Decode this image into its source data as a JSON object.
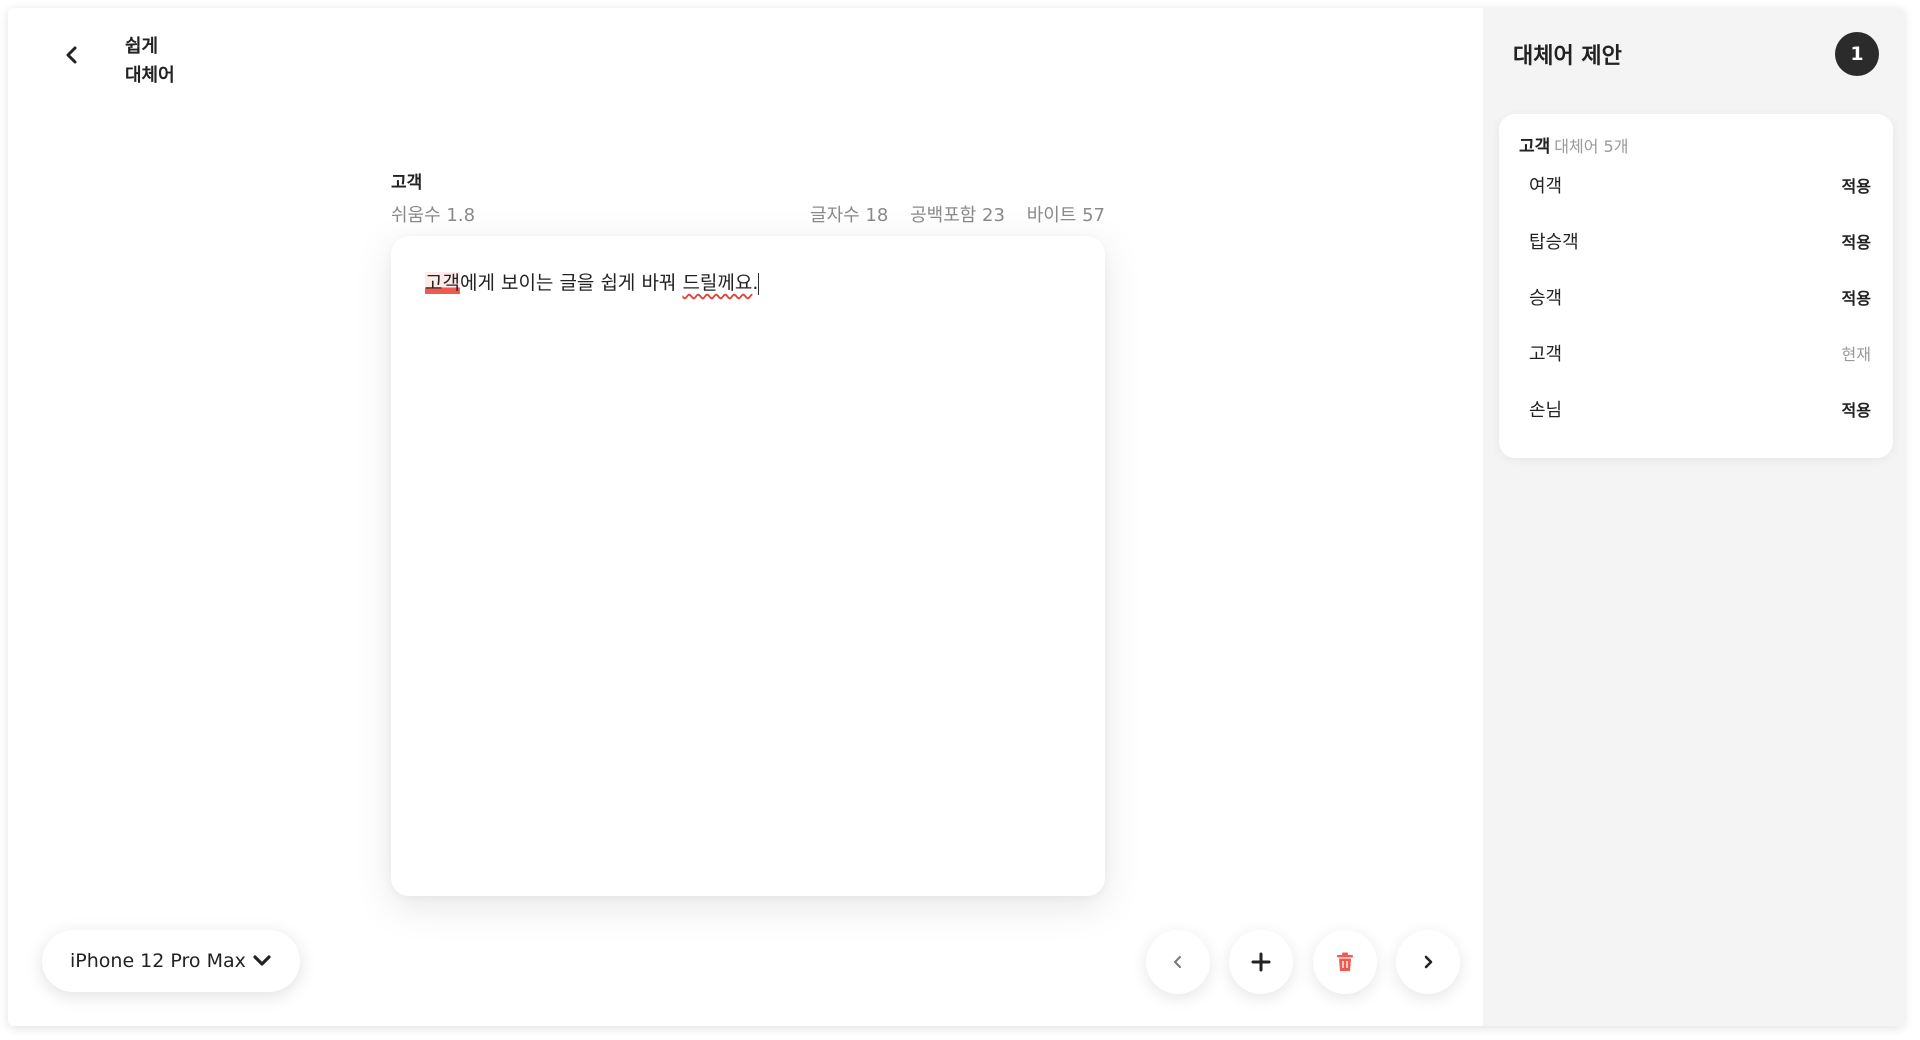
{
  "header": {
    "app_title": "쉽게\n대체어"
  },
  "document": {
    "title": "고객",
    "readability": "쉬움수 1.8",
    "char_count": "글자수 18",
    "with_spaces": "공백포함 23",
    "bytes": "바이트 57",
    "text_highlight": "고객",
    "text_middle": "에게 보이는 글을 쉽게 바꿔 ",
    "text_squiggle": "드릴께요",
    "text_end": "."
  },
  "device": {
    "selected": "iPhone 12 Pro Max"
  },
  "side": {
    "title": "대체어 제안",
    "badge": "1",
    "card": {
      "word": "고객",
      "count_label": "대체어 5개",
      "items": [
        {
          "word": "여객",
          "action": "적용"
        },
        {
          "word": "탑승객",
          "action": "적용"
        },
        {
          "word": "승객",
          "action": "적용"
        },
        {
          "word": "고객",
          "action": "현재"
        },
        {
          "word": "손님",
          "action": "적용"
        }
      ]
    }
  },
  "colors": {
    "accent_red": "#f05a4e",
    "badge_dark": "#2b2b2b",
    "panel_bg": "#f4f4f4"
  }
}
